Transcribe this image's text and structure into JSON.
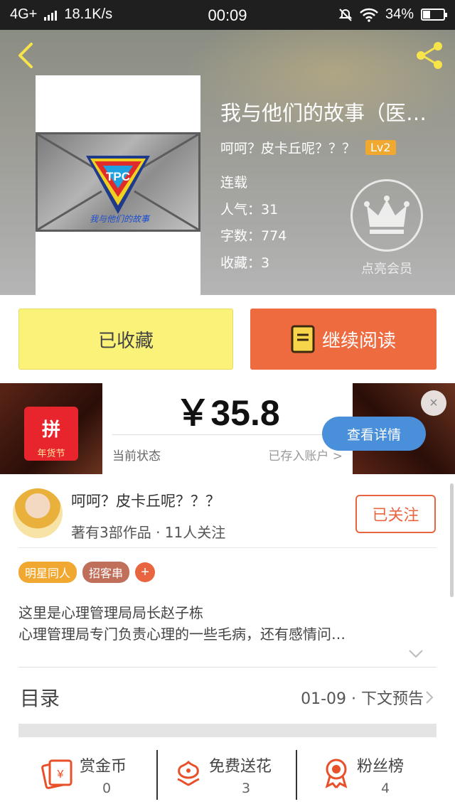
{
  "status_bar": {
    "network": "4G+",
    "speed": "18.1K/s",
    "time": "00:09",
    "battery": "34%",
    "battery_level": 0.34
  },
  "book": {
    "title": "我与他们的故事（医…",
    "author": "呵呵？皮卡丘呢？？？",
    "level": "Lv2",
    "status": "连载",
    "popularity": "人气：31",
    "word_count": "字数：774",
    "favorites": "收藏：3",
    "vip_label": "点亮会员",
    "cover_text": "我与他们的故事",
    "cover_logo": "TPC"
  },
  "actions": {
    "favorited_label": "已收藏",
    "continue_label": "继续阅读"
  },
  "ad": {
    "price": "￥35.8",
    "status_label": "当前状态",
    "status_value": "已存入账户 >",
    "detail_label": "查看详情",
    "close": "×",
    "logo_text": "年货节",
    "logo_mark": "拼"
  },
  "author_card": {
    "name": "呵呵？皮卡丘呢？？？",
    "stats": "著有3部作品 · 11人关注",
    "follow_label": "已关注"
  },
  "tags": [
    {
      "label": "明星同人",
      "color": "#f0a830"
    },
    {
      "label": "招客串",
      "color": "#c0705a"
    }
  ],
  "tag_add": "+",
  "description": [
    "这里是心理管理局局长赵子栋",
    "心理管理局专门负责心理的一些毛病，还有感情问…"
  ],
  "toc": {
    "label": "目录",
    "info": "01-09 · 下文预告"
  },
  "bottom_stats": [
    {
      "label": "赏金币",
      "value": "0",
      "icon": "reward-coin-icon"
    },
    {
      "label": "免费送花",
      "value": "3",
      "icon": "flower-icon"
    },
    {
      "label": "粉丝榜",
      "value": "4",
      "icon": "medal-icon"
    }
  ],
  "colors": {
    "accent_orange": "#ee6a3f",
    "favorite_yellow": "#fbf27a",
    "ad_blue": "#4a8fd9",
    "level_badge": "#f0a830"
  }
}
